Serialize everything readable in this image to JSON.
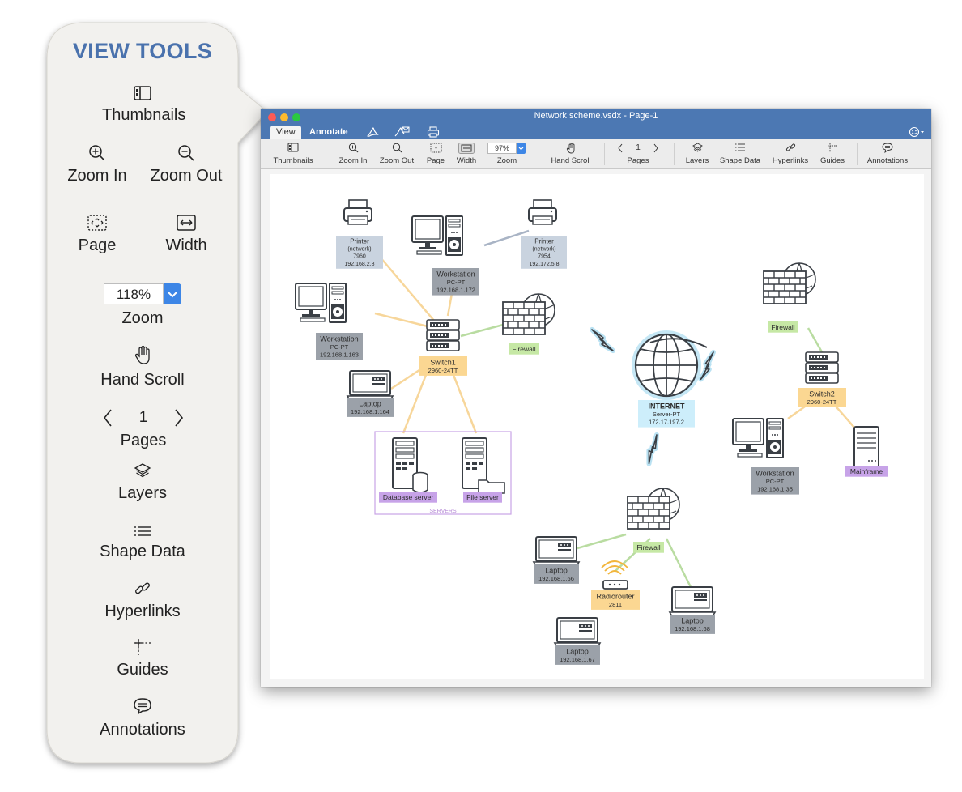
{
  "callout": {
    "title": "VIEW TOOLS",
    "thumbnails": "Thumbnails",
    "zoom_in": "Zoom In",
    "zoom_out": "Zoom Out",
    "page": "Page",
    "width": "Width",
    "zoom_value": "118%",
    "zoom": "Zoom",
    "hand_scroll": "Hand Scroll",
    "page_number": "1",
    "pages": "Pages",
    "layers": "Layers",
    "shape_data": "Shape Data",
    "hyperlinks": "Hyperlinks",
    "guides": "Guides",
    "annotations": "Annotations"
  },
  "window": {
    "title": "Network scheme.vsdx - Page-1",
    "tabs": {
      "view": "View",
      "annotate": "Annotate"
    },
    "colors": {
      "titlebar": "#4c78b3",
      "close": "#fd5b55",
      "minimize": "#febb2e",
      "zoom": "#2ac940"
    }
  },
  "toolbar": {
    "thumbnails": "Thumbnails",
    "zoom_in": "Zoom In",
    "zoom_out": "Zoom Out",
    "page": "Page",
    "width": "Width",
    "zoom_value": "97%",
    "zoom": "Zoom",
    "hand_scroll": "Hand Scroll",
    "page_number": "1",
    "pages": "Pages",
    "layers": "Layers",
    "shape_data": "Shape Data",
    "hyperlinks": "Hyperlinks",
    "guides": "Guides",
    "annotations": "Annotations"
  },
  "diagram": {
    "printer1": [
      "Printer",
      "(network)",
      "7960",
      "192.168.2.8"
    ],
    "printer2": [
      "Printer",
      "(network)",
      "7954",
      "192.172.5.8"
    ],
    "ws_top": [
      "Workstation",
      "PC-PT",
      "192.168.1.172"
    ],
    "ws_left": [
      "Workstation",
      "PC-PT",
      "192.168.1.163"
    ],
    "switch1": [
      "Switch1",
      "2960-24TT"
    ],
    "firewall1": "Firewall",
    "laptop1": [
      "Laptop",
      "192.168.1.164"
    ],
    "db_server": "Database server",
    "file_server": "File server",
    "servers_group": "SERVERS",
    "internet": [
      "INTERNET",
      "Server-PT",
      "172.17.197.2"
    ],
    "firewall2": "Firewall",
    "switch2": [
      "Switch2",
      "2960-24TT"
    ],
    "ws_right": [
      "Workstation",
      "PC-PT",
      "192.168.1.35"
    ],
    "mainframe": "Mainframe",
    "firewall3": "Firewall",
    "laptop_66": [
      "Laptop",
      "192.168.1.66"
    ],
    "radiorouter": [
      "Radiorouter",
      "2811"
    ],
    "laptop_68": [
      "Laptop",
      "192.168.1.68"
    ],
    "laptop_67": [
      "Laptop",
      "192.168.1.67"
    ]
  }
}
